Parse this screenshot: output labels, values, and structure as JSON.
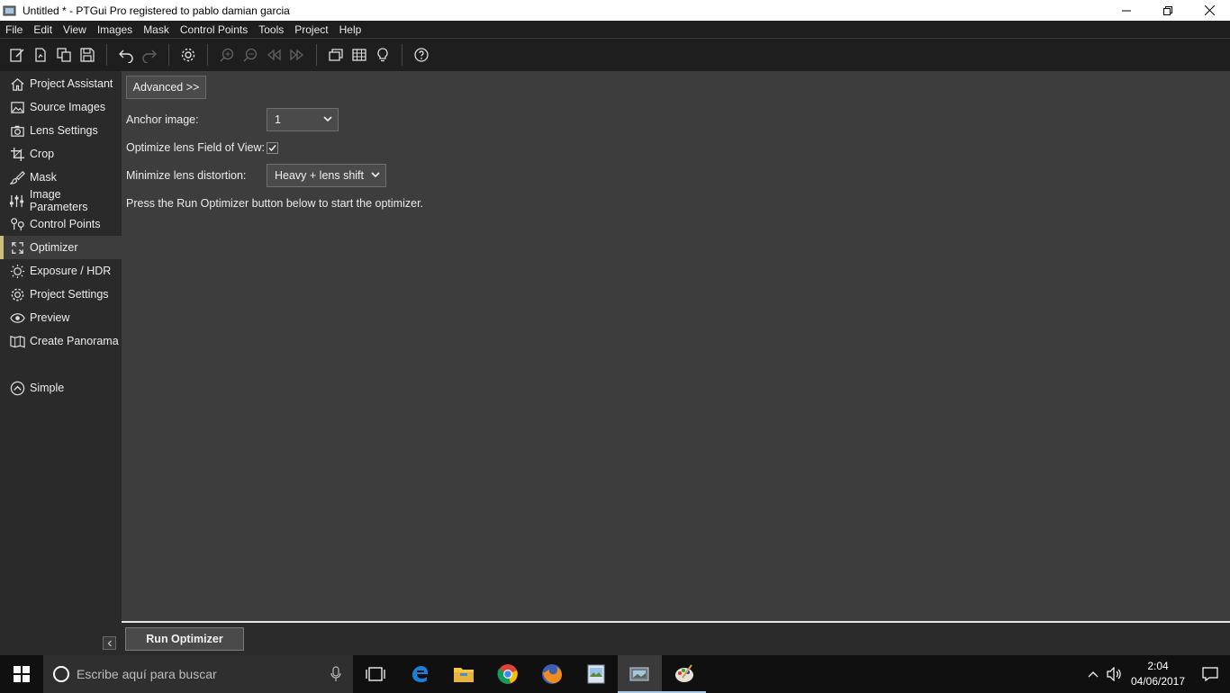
{
  "window": {
    "title": "Untitled * - PTGui Pro registered to pablo damian garcia"
  },
  "menu": [
    "File",
    "Edit",
    "View",
    "Images",
    "Mask",
    "Control Points",
    "Tools",
    "Project",
    "Help"
  ],
  "sidebar": {
    "items": [
      {
        "label": "Project Assistant",
        "icon": "home-icon"
      },
      {
        "label": "Source Images",
        "icon": "image-icon"
      },
      {
        "label": "Lens Settings",
        "icon": "camera-icon"
      },
      {
        "label": "Crop",
        "icon": "crop-icon"
      },
      {
        "label": "Mask",
        "icon": "brush-icon"
      },
      {
        "label": "Image Parameters",
        "icon": "sliders-icon"
      },
      {
        "label": "Control Points",
        "icon": "control-points-icon"
      },
      {
        "label": "Optimizer",
        "icon": "optimizer-icon",
        "active": true
      },
      {
        "label": "Exposure / HDR",
        "icon": "sun-icon"
      },
      {
        "label": "Project Settings",
        "icon": "gear-icon"
      },
      {
        "label": "Preview",
        "icon": "eye-icon"
      },
      {
        "label": "Create Panorama",
        "icon": "panorama-icon"
      }
    ],
    "simple": {
      "label": "Simple",
      "icon": "chevron-up-circle-icon"
    }
  },
  "optimizer": {
    "advanced_button": "Advanced >>",
    "anchor_label": "Anchor image:",
    "anchor_value": "1",
    "fov_label": "Optimize lens Field of View:",
    "fov_checked": true,
    "distortion_label": "Minimize lens distortion:",
    "distortion_value": "Heavy + lens shift",
    "hint": "Press the Run Optimizer button below to start the optimizer.",
    "run_button": "Run Optimizer"
  },
  "taskbar": {
    "search_placeholder": "Escribe aquí para buscar",
    "time": "2:04",
    "date": "04/06/2017"
  },
  "colors": {
    "accent": "#c9c080",
    "main_bg": "#3d3d3d",
    "sidebar_bg": "#2a2a2a"
  }
}
